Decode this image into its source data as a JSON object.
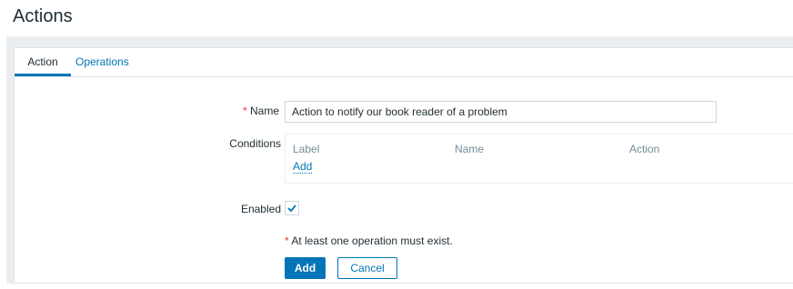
{
  "page": {
    "title": "Actions"
  },
  "tabs": [
    {
      "label": "Action",
      "active": true
    },
    {
      "label": "Operations",
      "active": false
    }
  ],
  "form": {
    "name": {
      "required_mark": "*",
      "label": "Name",
      "value": "Action to notify our book reader of a problem"
    },
    "conditions": {
      "label": "Conditions",
      "columns": [
        "Label",
        "Name",
        "Action"
      ],
      "add_link": "Add"
    },
    "enabled": {
      "label": "Enabled",
      "checked": true
    },
    "warning": {
      "required_mark": "*",
      "text": "At least one operation must exist."
    },
    "buttons": {
      "add": "Add",
      "cancel": "Cancel"
    }
  },
  "colors": {
    "accent": "#0275b8",
    "required": "#e33734",
    "background": "#ebeef0"
  },
  "icons": {
    "checkbox": "checkmark-icon"
  }
}
